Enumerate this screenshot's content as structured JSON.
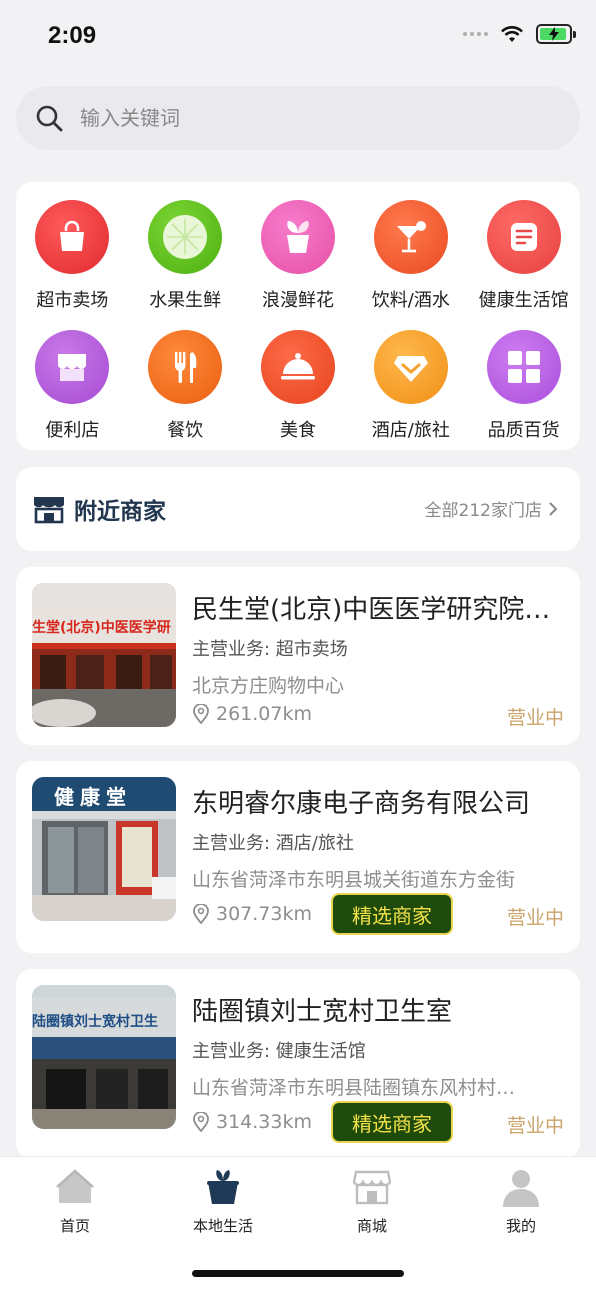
{
  "status_bar": {
    "time": "2:09"
  },
  "search": {
    "placeholder": "输入关键词"
  },
  "categories": [
    {
      "label": "超市卖场",
      "icon": "shopping-bag-icon",
      "color": "#ea3a3c"
    },
    {
      "label": "水果生鲜",
      "icon": "fruit-icon",
      "color": "#5fc21a"
    },
    {
      "label": "浪漫鲜花",
      "icon": "flower-pot-icon",
      "color": "#ef63b6"
    },
    {
      "label": "饮料/酒水",
      "icon": "cocktail-icon",
      "color": "#f25e33"
    },
    {
      "label": "健康生活馆",
      "icon": "document-icon",
      "color": "#f0504f"
    },
    {
      "label": "便利店",
      "icon": "store-icon",
      "color": "#b25ddd"
    },
    {
      "label": "餐饮",
      "icon": "fork-knife-icon",
      "color": "#f36b1a"
    },
    {
      "label": "美食",
      "icon": "food-cloche-icon",
      "color": "#f1522f"
    },
    {
      "label": "酒店/旅社",
      "icon": "diamond-icon",
      "color": "#f4a02c"
    },
    {
      "label": "品质百货",
      "icon": "grid-icon",
      "color": "#b45ee2"
    }
  ],
  "nearby": {
    "title": "附近商家",
    "all_link": "全部212家门店"
  },
  "merchants": [
    {
      "name": "民生堂(北京)中医医学研究院…",
      "business": "主营业务: 超市卖场",
      "address": "北京方庄购物中心",
      "distance": "261.07km",
      "status": "营业中",
      "badge": "",
      "photo_sign": "生堂(北京)中医医学研"
    },
    {
      "name": "东明睿尔康电子商务有限公司",
      "business": "主营业务: 酒店/旅社",
      "address": "山东省菏泽市东明县城关街道东方金街",
      "distance": "307.73km",
      "status": "营业中",
      "badge": "精选商家",
      "photo_sign": "健康堂"
    },
    {
      "name": "陆圈镇刘士宽村卫生室",
      "business": "主营业务: 健康生活馆",
      "address": "山东省菏泽市东明县陆圈镇东风村村…",
      "distance": "314.33km",
      "status": "营业中",
      "badge": "精选商家",
      "photo_sign": "陆圈镇刘士宽村卫生"
    }
  ],
  "tabs": [
    {
      "label": "首页",
      "icon": "home-icon"
    },
    {
      "label": "本地生活",
      "icon": "gift-bag-icon",
      "active": true
    },
    {
      "label": "商城",
      "icon": "mall-icon"
    },
    {
      "label": "我的",
      "icon": "user-icon"
    }
  ],
  "colors": {
    "accent_dark": "#22374f",
    "status_gold": "#c9a56b",
    "badge_bg": "#1e4a0b",
    "badge_text": "#f3e14a"
  }
}
